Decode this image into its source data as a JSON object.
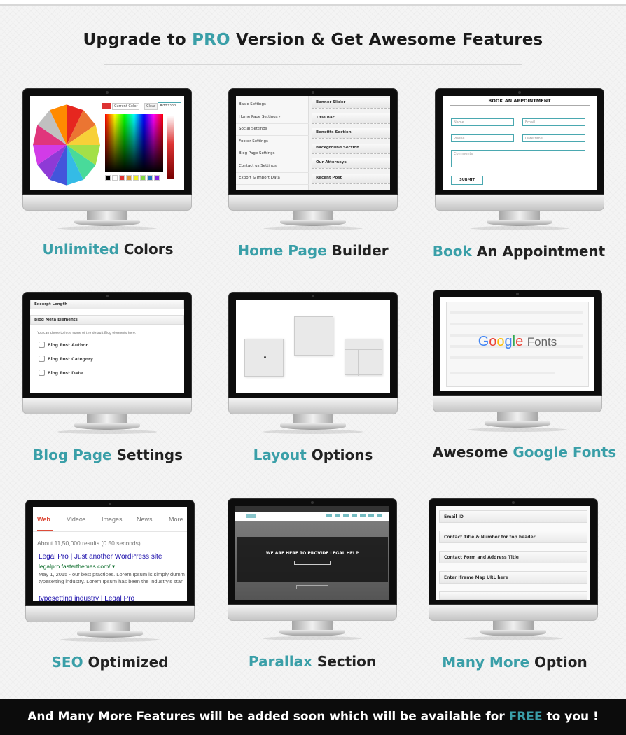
{
  "header": {
    "pre": "Upgrade to ",
    "accent": "PRO",
    "post": " Version & Get Awesome Features"
  },
  "colors": {
    "accent": "#3a9fa8",
    "footer_bg": "#0c0c0c"
  },
  "features": [
    {
      "accent": "Unlimited",
      "rest": " Colors"
    },
    {
      "accent": "Home Page",
      "rest": " Builder"
    },
    {
      "accent": "Book",
      "rest": " An Appointment"
    },
    {
      "accent": "Blog Page",
      "rest": " Settings"
    },
    {
      "accent": "Layout",
      "rest": " Options"
    },
    {
      "pre": "Awesome ",
      "accent": "Google Fonts"
    },
    {
      "accent": "SEO",
      "rest": " Optimized"
    },
    {
      "accent": "Parallax",
      "rest": " Section"
    },
    {
      "accent": "Many More",
      "rest": " Option"
    }
  ],
  "screen_colors": {
    "current_label": "Current Color",
    "clear_label": "Clear",
    "hex": "#dd3333"
  },
  "screen_builder": {
    "left": [
      "Basic Settings",
      "Home Page Settings",
      "Social Settings",
      "Footer Settings",
      "Blog Page Settings",
      "Contact us Settings",
      "Export & Import Data"
    ],
    "right": [
      "Banner Slider",
      "Title Bar",
      "Benefits Section",
      "Background Section",
      "Our Attorneys",
      "Recent Post"
    ]
  },
  "screen_appointment": {
    "title": "BOOK AN APPOINTMENT",
    "name": "Name",
    "email": "Email",
    "phone": "Phone",
    "datetime": "Date time",
    "comments": "Comments",
    "submit": "SUBMIT"
  },
  "screen_blog": {
    "excerpt": "Excerpt Length",
    "meta": "Blog Meta Elements",
    "hint": "You can chose to hide some of the default Blog elements here.",
    "items": [
      "Blog Post Author.",
      "Blog Post Category",
      "Blog Post Date"
    ]
  },
  "screen_fonts": {
    "google": "Google",
    "fonts": "Fonts"
  },
  "screen_seo": {
    "tabs": [
      "Web",
      "Videos",
      "Images",
      "News",
      "More"
    ],
    "results": "About 11,50,000 results (0.50 seconds)",
    "title": "Legal Pro | Just another WordPress site",
    "url": "legalpro.fasterthemes.com/",
    "snippet1": "May 1, 2015 - our best practices. Lorem Ipsum is simply dumm",
    "snippet2": "typesetting industry. Lorem Ipsum has been the industry's stan",
    "title2": "typesetting industry | Legal Pro"
  },
  "screen_parallax": {
    "heading": "WE ARE HERE TO PROVIDE LEGAL HELP"
  },
  "screen_more": {
    "items": [
      "Email ID",
      "Contact Title & Number for top header",
      "Contact Form and Address Title",
      "Enter Iframe Map URL here"
    ]
  },
  "footer": {
    "pre": "And Many More Features will be added soon which will be available for ",
    "accent": "FREE",
    "post": " to you !"
  }
}
